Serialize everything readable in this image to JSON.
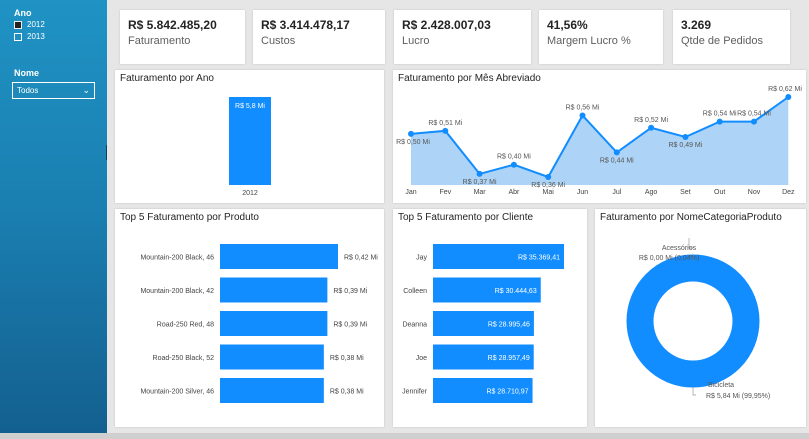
{
  "slicers": {
    "ano_title": "Ano",
    "ano_options": [
      {
        "label": "2012",
        "checked": true
      },
      {
        "label": "2013",
        "checked": false
      }
    ],
    "nome_title": "Nome",
    "nome_value": "Todos"
  },
  "kpis": [
    {
      "value": "R$ 5.842.485,20",
      "label": "Faturamento"
    },
    {
      "value": "R$ 3.414.478,17",
      "label": "Custos"
    },
    {
      "value": "R$ 2.428.007,03",
      "label": "Lucro"
    },
    {
      "value": "41,56%",
      "label": "Margem Lucro %"
    },
    {
      "value": "3.269",
      "label": "Qtde de Pedidos"
    }
  ],
  "fat_ano": {
    "title": "Faturamento por Ano",
    "categories": [
      "2012"
    ],
    "values": [
      5.8
    ],
    "data_labels": [
      "R$ 5,8 Mi"
    ]
  },
  "fat_mes": {
    "title": "Faturamento por Mês Abreviado",
    "categories": [
      "Jan",
      "Fev",
      "Mar",
      "Abr",
      "Mai",
      "Jun",
      "Jul",
      "Ago",
      "Set",
      "Out",
      "Nov",
      "Dez"
    ],
    "values": [
      0.5,
      0.51,
      0.37,
      0.4,
      0.36,
      0.56,
      0.44,
      0.52,
      0.49,
      0.54,
      0.54,
      0.62
    ],
    "data_labels": [
      "R$ 0,50 Mi",
      "R$ 0,51 Mi",
      "R$ 0,37 Mi",
      "R$ 0,40 Mi",
      "R$ 0,36 Mi",
      "R$ 0,56 Mi",
      "R$ 0,44 Mi",
      "R$ 0,52 Mi",
      "R$ 0,49 Mi",
      "R$ 0,54 Mi",
      "R$ 0,54 Mi",
      "R$ 0,62 Mi"
    ]
  },
  "top_produto": {
    "title": "Top 5 Faturamento por Produto",
    "categories": [
      "Mountain-200 Black, 46",
      "Mountain-200 Black, 42",
      "Road-250 Red, 48",
      "Road-250 Black, 52",
      "Mountain-200 Silver, 46"
    ],
    "values": [
      0.42,
      0.39,
      0.39,
      0.38,
      0.38
    ],
    "data_labels": [
      "R$ 0,42 Mi",
      "R$ 0,39 Mi",
      "R$ 0,39 Mi",
      "R$ 0,38 Mi",
      "R$ 0,38 Mi"
    ]
  },
  "top_cliente": {
    "title": "Top 5 Faturamento por Cliente",
    "categories": [
      "Jay",
      "Colleen",
      "Deanna",
      "Joe",
      "Jennifer"
    ],
    "values": [
      35369.41,
      30444.63,
      28995.46,
      28957.49,
      28710.97
    ],
    "data_labels": [
      "R$ 35.369,41",
      "R$ 30.444,63",
      "R$ 28.995,46",
      "R$ 28.957,49",
      "R$ 28.710,97"
    ]
  },
  "categoria": {
    "title": "Faturamento por NomeCategoriaProduto",
    "slices": [
      {
        "name": "Acessórios",
        "label": "R$ 0,00 Mi (0,04%)",
        "percent": 0.04
      },
      {
        "name": "Bicicleta",
        "label": "R$ 5,84 Mi (99,95%)",
        "percent": 99.95
      }
    ]
  },
  "colors": {
    "accent": "#118dff",
    "area_fill": "#9fcdf5",
    "sidebar": "#1a7eb0"
  },
  "chart_data": [
    {
      "type": "bar",
      "title": "Faturamento por Ano",
      "categories": [
        "2012"
      ],
      "values": [
        5.8
      ],
      "ylabel": ""
    },
    {
      "type": "area",
      "title": "Faturamento por Mês Abreviado",
      "categories": [
        "Jan",
        "Fev",
        "Mar",
        "Abr",
        "Mai",
        "Jun",
        "Jul",
        "Ago",
        "Set",
        "Out",
        "Nov",
        "Dez"
      ],
      "values": [
        0.5,
        0.51,
        0.37,
        0.4,
        0.36,
        0.56,
        0.44,
        0.52,
        0.49,
        0.54,
        0.54,
        0.62
      ]
    },
    {
      "type": "bar",
      "title": "Top 5 Faturamento por Produto",
      "categories": [
        "Mountain-200 Black, 46",
        "Mountain-200 Black, 42",
        "Road-250 Red, 48",
        "Road-250 Black, 52",
        "Mountain-200 Silver, 46"
      ],
      "values": [
        0.42,
        0.39,
        0.39,
        0.38,
        0.38
      ]
    },
    {
      "type": "bar",
      "title": "Top 5 Faturamento por Cliente",
      "categories": [
        "Jay",
        "Colleen",
        "Deanna",
        "Joe",
        "Jennifer"
      ],
      "values": [
        35369.41,
        30444.63,
        28995.46,
        28957.49,
        28710.97
      ]
    },
    {
      "type": "pie",
      "title": "Faturamento por NomeCategoriaProduto",
      "categories": [
        "Acessórios",
        "Bicicleta"
      ],
      "values": [
        0.04,
        99.95
      ]
    }
  ]
}
